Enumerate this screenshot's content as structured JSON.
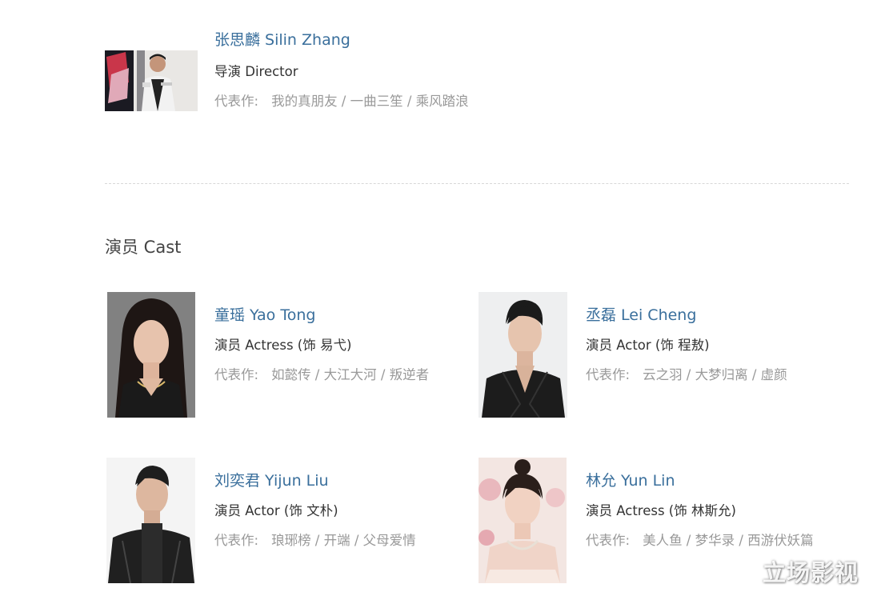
{
  "director": {
    "name": "张思麟 Silin Zhang",
    "role": "导演 Director",
    "works_label": "代表作:",
    "works": "我的真朋友 / 一曲三笙 / 乘风踏浪"
  },
  "cast_section": {
    "title": "演员 Cast"
  },
  "cast": [
    {
      "name": "童瑶 Yao Tong",
      "role": "演员 Actress (饰 易弋)",
      "works_label": "代表作:",
      "works": "如懿传 / 大江大河 / 叛逆者"
    },
    {
      "name": "丞磊 Lei Cheng",
      "role": "演员 Actor (饰 程敖)",
      "works_label": "代表作:",
      "works": "云之羽 / 大梦归离 / 虚颜"
    },
    {
      "name": "刘奕君 Yijun Liu",
      "role": "演员 Actor (饰 文朴)",
      "works_label": "代表作:",
      "works": "琅琊榜 / 开端 / 父母爱情"
    },
    {
      "name": "林允 Yun Lin",
      "role": "演员 Actress (饰 林斯允)",
      "works_label": "代表作:",
      "works": "美人鱼 / 梦华录 / 西游伏妖篇"
    }
  ],
  "watermark": "立场影视"
}
